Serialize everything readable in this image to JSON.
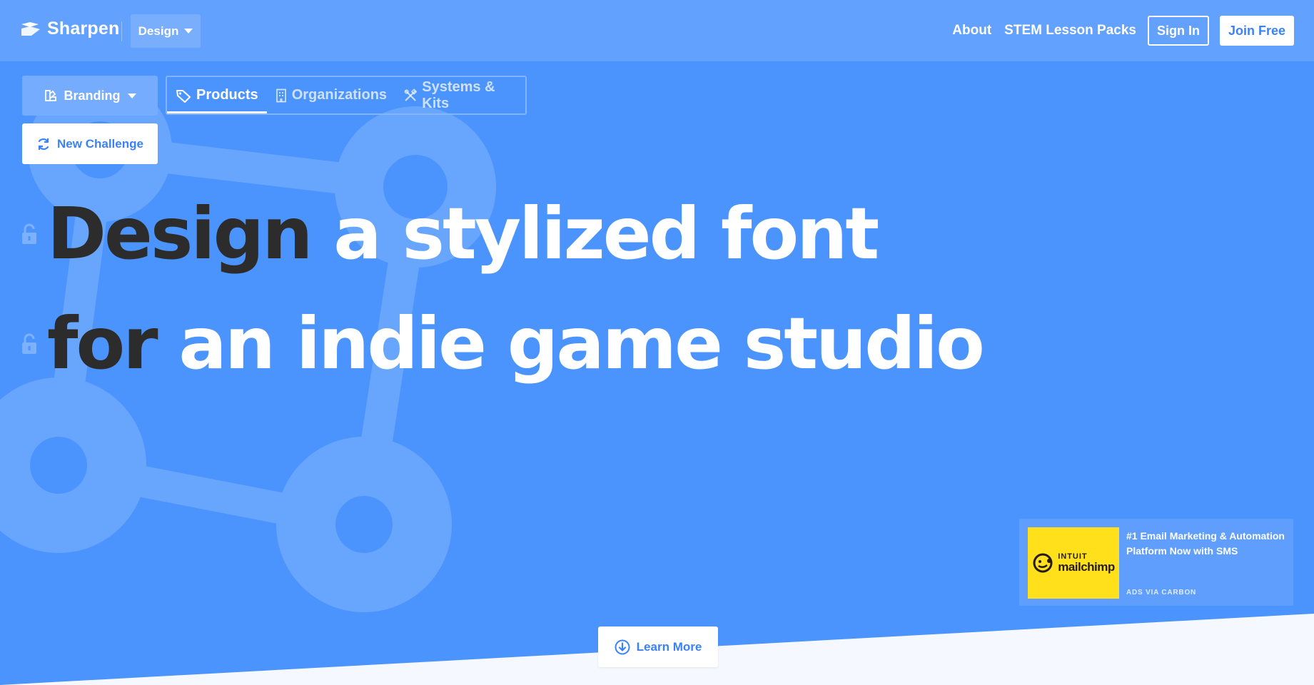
{
  "header": {
    "brand": "Sharpen",
    "category_dropdown": "Design",
    "nav": {
      "about": "About",
      "stem": "STEM Lesson Packs",
      "sign_in": "Sign In",
      "join": "Join Free"
    }
  },
  "controls": {
    "branding_dropdown": "Branding",
    "tabs": [
      {
        "label": "Products",
        "active": true
      },
      {
        "label": "Organizations",
        "active": false
      },
      {
        "label": "Systems & Kits",
        "active": false
      }
    ],
    "new_challenge": "New Challenge"
  },
  "headline": {
    "line1": {
      "keyword": "Design",
      "rest": "a stylized font"
    },
    "line2": {
      "keyword": "for",
      "rest": "an indie game studio"
    }
  },
  "ad": {
    "logo_line1": "INTUIT",
    "logo_line2": "mailchimp",
    "text": "#1 Email Marketing & Automation Platform Now with SMS",
    "via": "ADS VIA CARBON"
  },
  "learn_more": "Learn More",
  "colors": {
    "background": "#4c94fd",
    "header": "#62a1fd",
    "accent": "#3b82f6",
    "ad_yellow": "#ffe01b"
  }
}
